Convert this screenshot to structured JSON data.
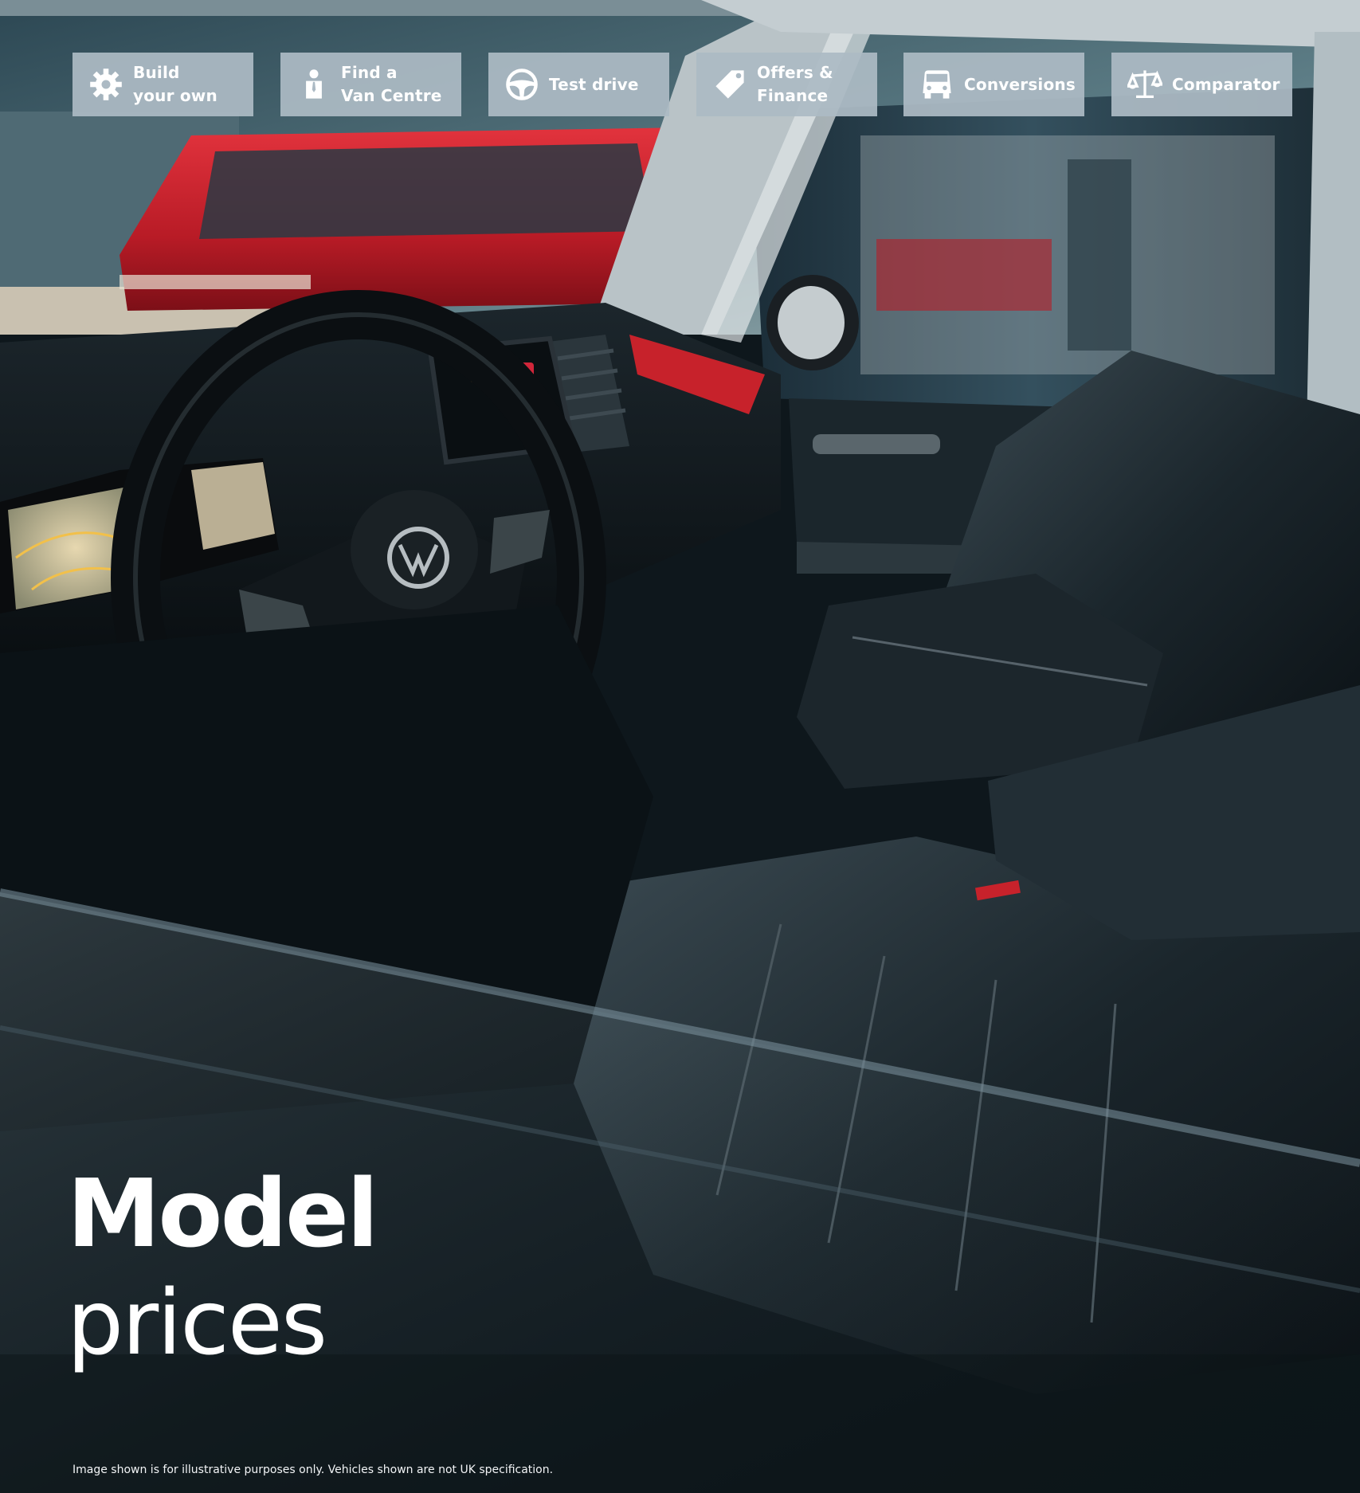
{
  "nav": {
    "items": [
      {
        "label": "Build\nyour own",
        "icon": "gear-icon"
      },
      {
        "label": "Find a\nVan Centre",
        "icon": "person-icon"
      },
      {
        "label": "Test drive",
        "icon": "steering-wheel-icon"
      },
      {
        "label": "Offers &\nFinance",
        "icon": "price-tag-icon"
      },
      {
        "label": "Conversions",
        "icon": "van-icon"
      },
      {
        "label": "Comparator",
        "icon": "scales-icon"
      }
    ]
  },
  "title": {
    "line1": "Model",
    "line2": "prices"
  },
  "disclaimer": "Image shown is for illustrative purposes only. Vehicles shown are not UK specification.",
  "colors": {
    "nav_button_bg": "#acbac4",
    "text": "#ffffff",
    "red_van": "#c8202c",
    "interior_dark": "#0d1419"
  }
}
